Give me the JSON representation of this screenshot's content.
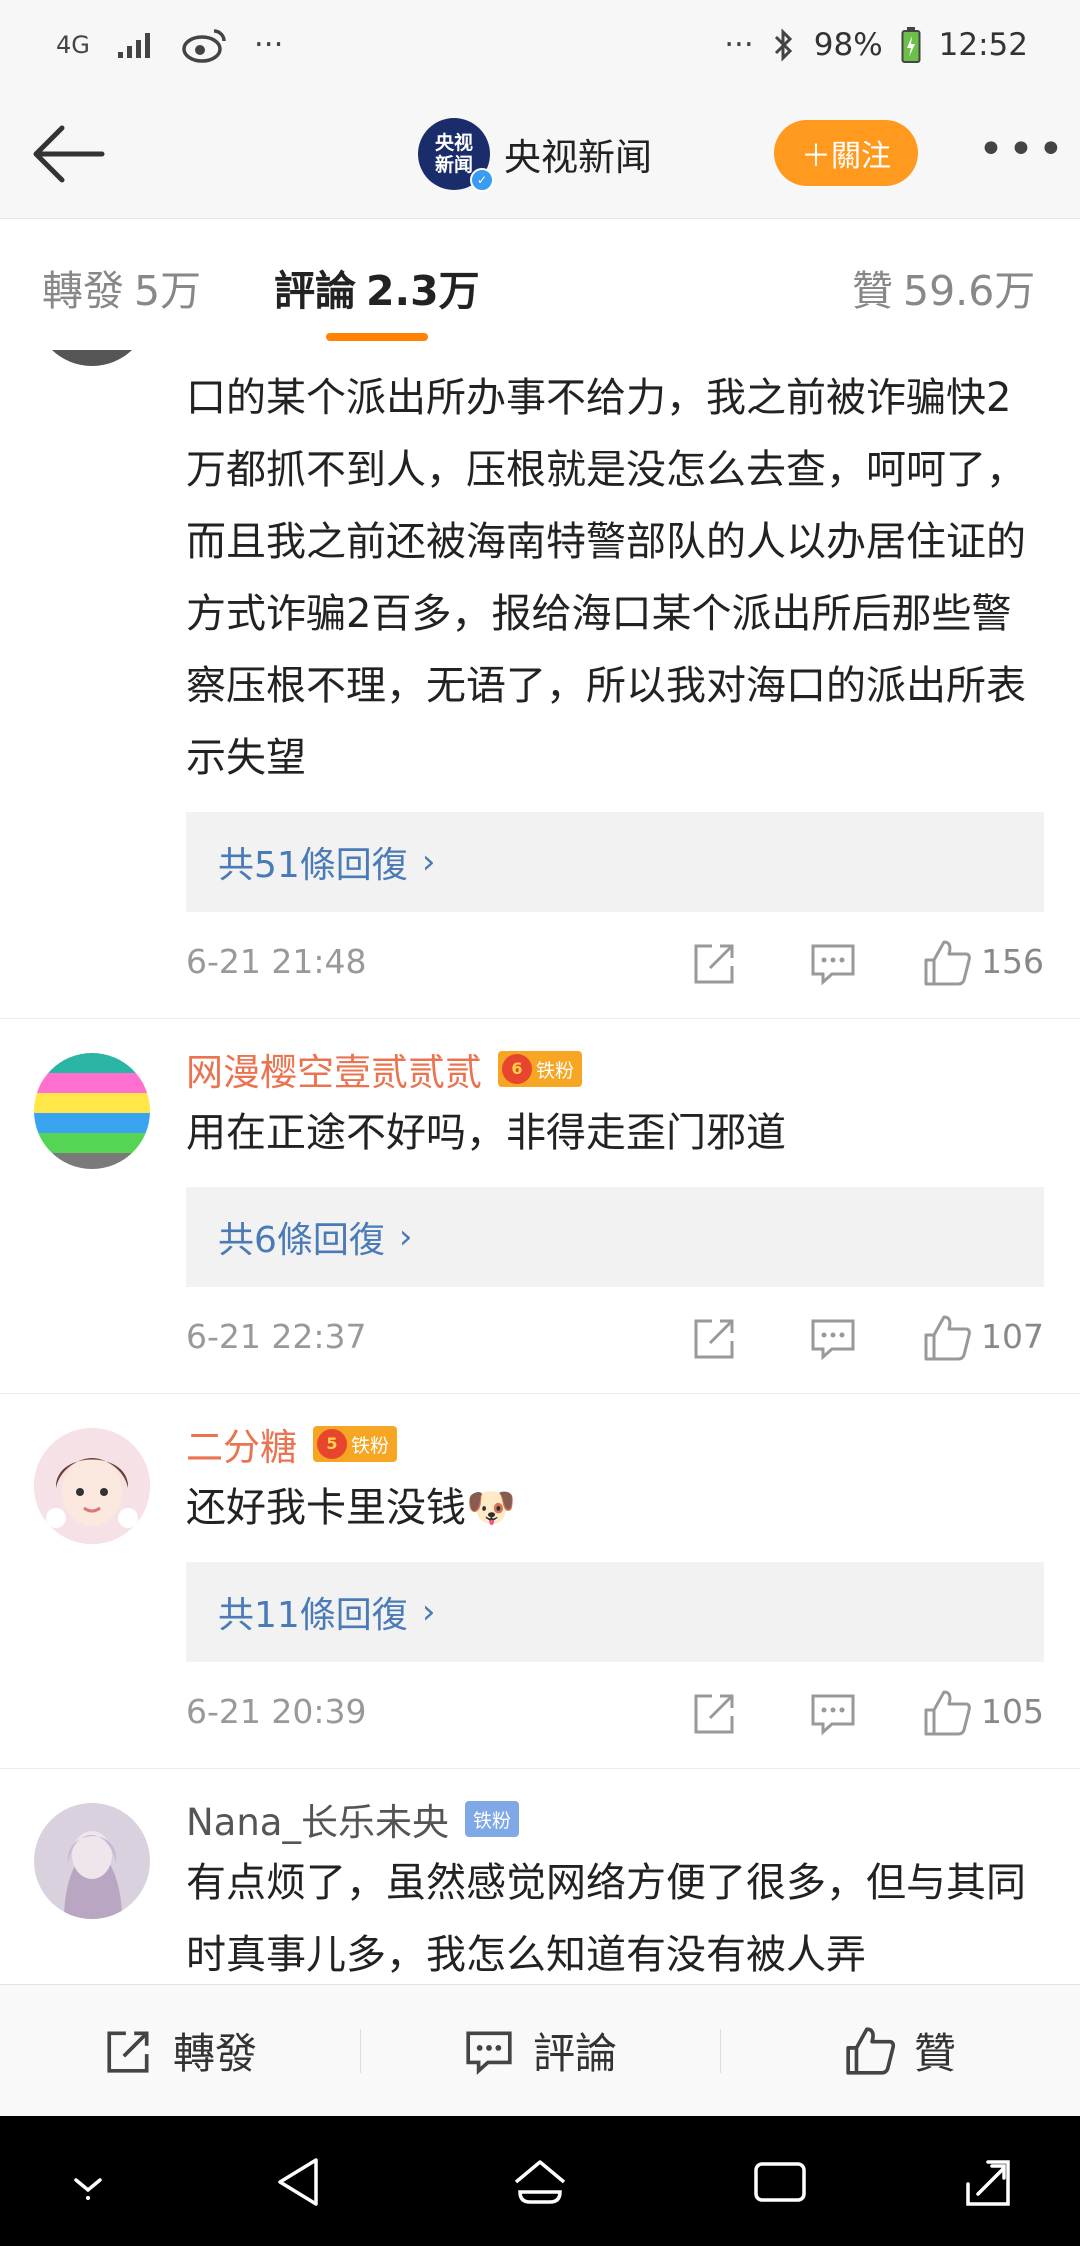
{
  "status": {
    "network": "4G",
    "battery": "98%",
    "time": "12:52",
    "overflow": "···"
  },
  "header": {
    "account_name": "央视新闻",
    "logo_text_line1": "央视",
    "logo_text_line2": "新闻",
    "follow_label": "＋關注",
    "more_label": "•••"
  },
  "tabs": [
    {
      "label": "轉發",
      "count": "5万"
    },
    {
      "label": "評論",
      "count": "2.3万"
    },
    {
      "label": "贊",
      "count": "59.6万"
    }
  ],
  "comments": [
    {
      "username": "",
      "text": "口的某个派出所办事不给力，我之前被诈骗快2万都抓不到人，压根就是没怎么去查，呵呵了，而且我之前还被海南特警部队的人以办居住证的方式诈骗2百多，报给海口某个派出所后那些警察压根不理，无语了，所以我对海口的派出所表示失望",
      "replies": "共51條回復",
      "time": "6-21 21:48",
      "likes": "156"
    },
    {
      "username": "网漫樱空壹贰贰贰",
      "badge": "铁粉",
      "badge_level": "6",
      "text": "用在正途不好吗，非得走歪门邪道",
      "replies": "共6條回復",
      "time": "6-21 22:37",
      "likes": "107"
    },
    {
      "username": "二分糖",
      "badge": "铁粉",
      "badge_level": "5",
      "text": "还好我卡里没钱🐶",
      "replies": "共11條回復",
      "time": "6-21 20:39",
      "likes": "105"
    },
    {
      "username": "Nana_长乐未央",
      "badge": "铁粉",
      "text": "有点烦了，虽然感觉网络方便了很多，但与其同时真事儿多，我怎么知道有没有被人弄"
    }
  ],
  "bottom_bar": {
    "repost": "轉發",
    "comment": "評論",
    "like": "贊"
  },
  "icons": {
    "back": "arrow-left-icon",
    "repost": "share-square-icon",
    "comment": "comment-bubble-icon",
    "like": "thumbs-up-icon"
  },
  "colors": {
    "accent_orange": "#ff8200",
    "follow_button": "#ff9a1f",
    "username": "#eb7350",
    "reply_link": "#4a7bb7"
  }
}
